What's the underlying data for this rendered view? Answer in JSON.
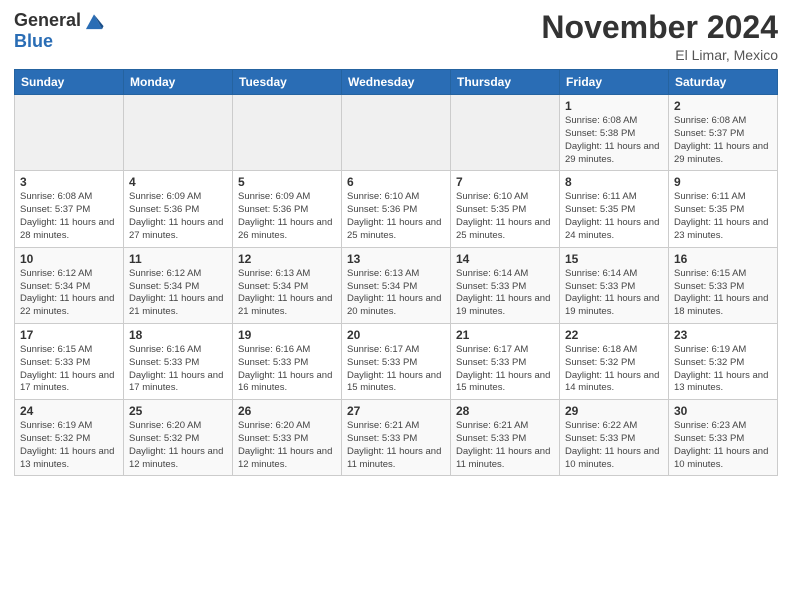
{
  "logo": {
    "general": "General",
    "blue": "Blue"
  },
  "header": {
    "month": "November 2024",
    "location": "El Limar, Mexico"
  },
  "weekdays": [
    "Sunday",
    "Monday",
    "Tuesday",
    "Wednesday",
    "Thursday",
    "Friday",
    "Saturday"
  ],
  "weeks": [
    [
      {
        "day": "",
        "info": ""
      },
      {
        "day": "",
        "info": ""
      },
      {
        "day": "",
        "info": ""
      },
      {
        "day": "",
        "info": ""
      },
      {
        "day": "",
        "info": ""
      },
      {
        "day": "1",
        "info": "Sunrise: 6:08 AM\nSunset: 5:38 PM\nDaylight: 11 hours and 29 minutes."
      },
      {
        "day": "2",
        "info": "Sunrise: 6:08 AM\nSunset: 5:37 PM\nDaylight: 11 hours and 29 minutes."
      }
    ],
    [
      {
        "day": "3",
        "info": "Sunrise: 6:08 AM\nSunset: 5:37 PM\nDaylight: 11 hours and 28 minutes."
      },
      {
        "day": "4",
        "info": "Sunrise: 6:09 AM\nSunset: 5:36 PM\nDaylight: 11 hours and 27 minutes."
      },
      {
        "day": "5",
        "info": "Sunrise: 6:09 AM\nSunset: 5:36 PM\nDaylight: 11 hours and 26 minutes."
      },
      {
        "day": "6",
        "info": "Sunrise: 6:10 AM\nSunset: 5:36 PM\nDaylight: 11 hours and 25 minutes."
      },
      {
        "day": "7",
        "info": "Sunrise: 6:10 AM\nSunset: 5:35 PM\nDaylight: 11 hours and 25 minutes."
      },
      {
        "day": "8",
        "info": "Sunrise: 6:11 AM\nSunset: 5:35 PM\nDaylight: 11 hours and 24 minutes."
      },
      {
        "day": "9",
        "info": "Sunrise: 6:11 AM\nSunset: 5:35 PM\nDaylight: 11 hours and 23 minutes."
      }
    ],
    [
      {
        "day": "10",
        "info": "Sunrise: 6:12 AM\nSunset: 5:34 PM\nDaylight: 11 hours and 22 minutes."
      },
      {
        "day": "11",
        "info": "Sunrise: 6:12 AM\nSunset: 5:34 PM\nDaylight: 11 hours and 21 minutes."
      },
      {
        "day": "12",
        "info": "Sunrise: 6:13 AM\nSunset: 5:34 PM\nDaylight: 11 hours and 21 minutes."
      },
      {
        "day": "13",
        "info": "Sunrise: 6:13 AM\nSunset: 5:34 PM\nDaylight: 11 hours and 20 minutes."
      },
      {
        "day": "14",
        "info": "Sunrise: 6:14 AM\nSunset: 5:33 PM\nDaylight: 11 hours and 19 minutes."
      },
      {
        "day": "15",
        "info": "Sunrise: 6:14 AM\nSunset: 5:33 PM\nDaylight: 11 hours and 19 minutes."
      },
      {
        "day": "16",
        "info": "Sunrise: 6:15 AM\nSunset: 5:33 PM\nDaylight: 11 hours and 18 minutes."
      }
    ],
    [
      {
        "day": "17",
        "info": "Sunrise: 6:15 AM\nSunset: 5:33 PM\nDaylight: 11 hours and 17 minutes."
      },
      {
        "day": "18",
        "info": "Sunrise: 6:16 AM\nSunset: 5:33 PM\nDaylight: 11 hours and 17 minutes."
      },
      {
        "day": "19",
        "info": "Sunrise: 6:16 AM\nSunset: 5:33 PM\nDaylight: 11 hours and 16 minutes."
      },
      {
        "day": "20",
        "info": "Sunrise: 6:17 AM\nSunset: 5:33 PM\nDaylight: 11 hours and 15 minutes."
      },
      {
        "day": "21",
        "info": "Sunrise: 6:17 AM\nSunset: 5:33 PM\nDaylight: 11 hours and 15 minutes."
      },
      {
        "day": "22",
        "info": "Sunrise: 6:18 AM\nSunset: 5:32 PM\nDaylight: 11 hours and 14 minutes."
      },
      {
        "day": "23",
        "info": "Sunrise: 6:19 AM\nSunset: 5:32 PM\nDaylight: 11 hours and 13 minutes."
      }
    ],
    [
      {
        "day": "24",
        "info": "Sunrise: 6:19 AM\nSunset: 5:32 PM\nDaylight: 11 hours and 13 minutes."
      },
      {
        "day": "25",
        "info": "Sunrise: 6:20 AM\nSunset: 5:32 PM\nDaylight: 11 hours and 12 minutes."
      },
      {
        "day": "26",
        "info": "Sunrise: 6:20 AM\nSunset: 5:33 PM\nDaylight: 11 hours and 12 minutes."
      },
      {
        "day": "27",
        "info": "Sunrise: 6:21 AM\nSunset: 5:33 PM\nDaylight: 11 hours and 11 minutes."
      },
      {
        "day": "28",
        "info": "Sunrise: 6:21 AM\nSunset: 5:33 PM\nDaylight: 11 hours and 11 minutes."
      },
      {
        "day": "29",
        "info": "Sunrise: 6:22 AM\nSunset: 5:33 PM\nDaylight: 11 hours and 10 minutes."
      },
      {
        "day": "30",
        "info": "Sunrise: 6:23 AM\nSunset: 5:33 PM\nDaylight: 11 hours and 10 minutes."
      }
    ]
  ]
}
